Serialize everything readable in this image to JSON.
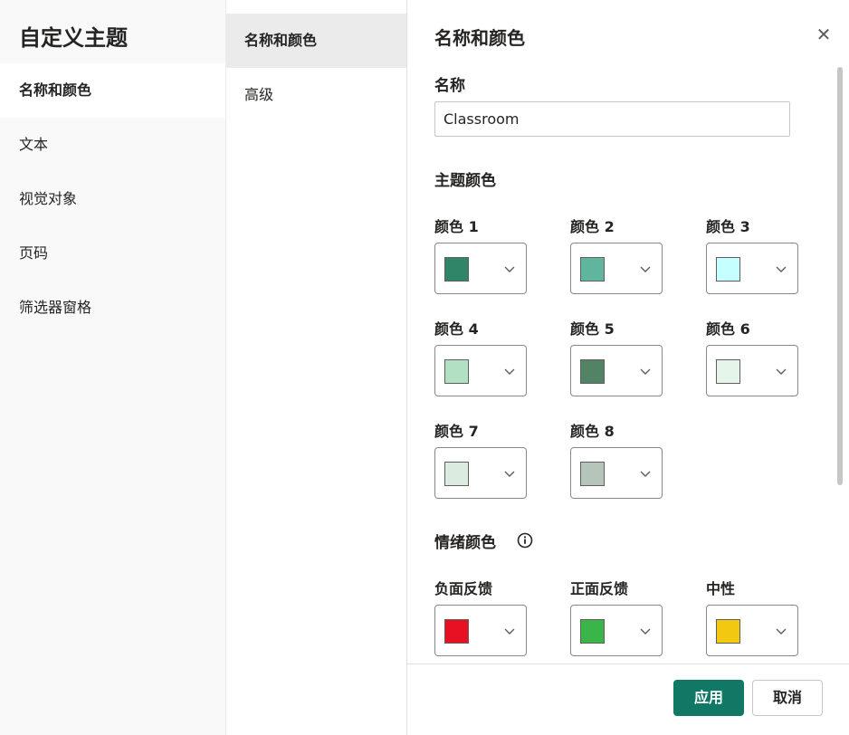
{
  "nav": {
    "title": "自定义主题",
    "items": [
      {
        "label": "名称和颜色"
      },
      {
        "label": "文本"
      },
      {
        "label": "视觉对象"
      },
      {
        "label": "页码"
      },
      {
        "label": "筛选器窗格"
      }
    ]
  },
  "subnav": {
    "items": [
      {
        "label": "名称和颜色"
      },
      {
        "label": "高级"
      }
    ]
  },
  "panel": {
    "title": "名称和颜色",
    "name_label": "名称",
    "name_value": "Classroom",
    "theme_colors_label": "主题颜色",
    "theme_colors": [
      {
        "label": "颜色 1",
        "color": "#2e8567"
      },
      {
        "label": "颜色 2",
        "color": "#5fb59e"
      },
      {
        "label": "颜色 3",
        "color": "#c6ffff"
      },
      {
        "label": "颜色 4",
        "color": "#b2e0c2"
      },
      {
        "label": "颜色 5",
        "color": "#538365"
      },
      {
        "label": "颜色 6",
        "color": "#e6f5e9"
      },
      {
        "label": "颜色 7",
        "color": "#dcebe0"
      },
      {
        "label": "颜色 8",
        "color": "#b6c5b9"
      }
    ],
    "sentiment_label": "情绪颜色",
    "sentiment_colors": [
      {
        "label": "负面反馈",
        "color": "#e81123"
      },
      {
        "label": "正面反馈",
        "color": "#3ab54a"
      },
      {
        "label": "中性",
        "color": "#f2c811"
      }
    ]
  },
  "footer": {
    "apply_label": "应用",
    "cancel_label": "取消"
  },
  "icons": {
    "close": "close-icon",
    "chevron": "chevron-down-icon",
    "info": "info-icon"
  },
  "accent": "#117865"
}
